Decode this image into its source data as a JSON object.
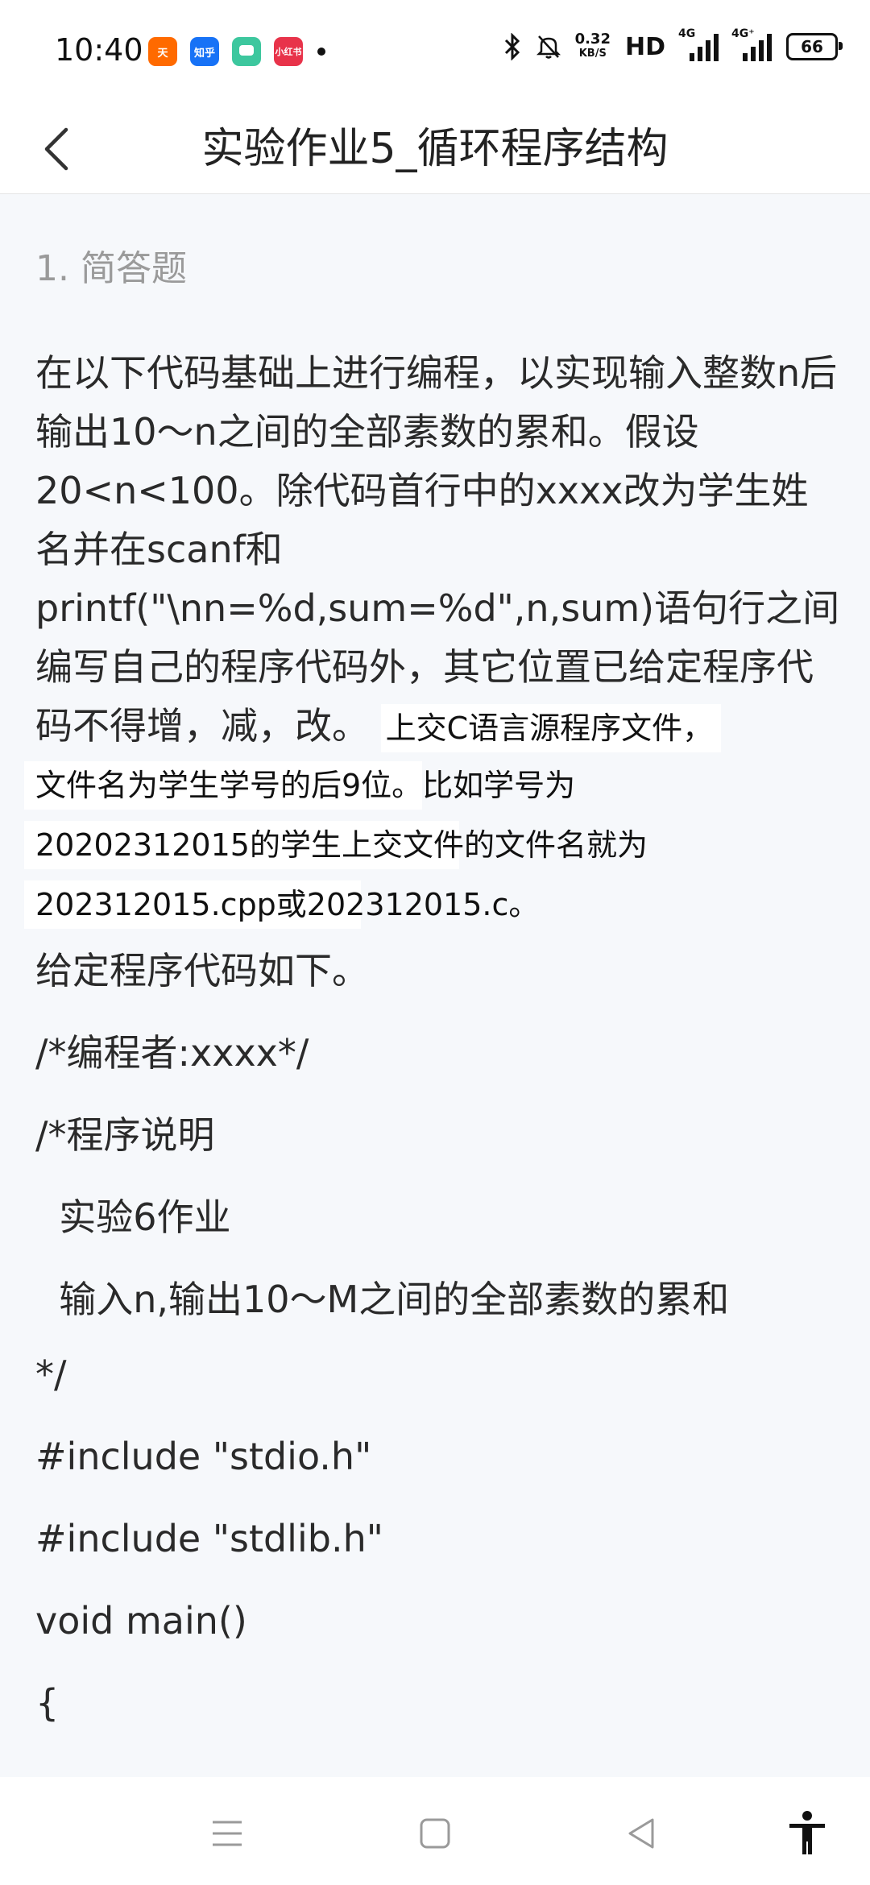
{
  "status_bar": {
    "time": "10:40",
    "apps": [
      {
        "name": "taobao-app-icon",
        "label": "天",
        "color": "#ff6a00"
      },
      {
        "name": "zhihu-app-icon",
        "label": "知乎",
        "color": "#1772f6"
      },
      {
        "name": "chat-app-icon",
        "label": "",
        "color": "#3dc79e"
      },
      {
        "name": "xiaohongshu-app-icon",
        "label": "小红书",
        "color": "#e8334a"
      }
    ],
    "net_speed_value": "0.32",
    "net_speed_unit": "KB/S",
    "hd_label": "HD",
    "signal1_label": "4G",
    "signal2_label": "4G⁺",
    "battery": "66"
  },
  "header": {
    "title": "实验作业5_循环程序结构"
  },
  "question": {
    "type_label": "1. 简答题",
    "body": "在以下代码基础上进行编程，以实现输入整数n后输出10～n之间的全部素数的累和。假设20<n<100。除代码首行中的xxxx改为学生姓名并在scanf和printf(\"\\nn=%d,sum=%d\",n,sum)语句行之间编写自己的程序代码外，其它位置已给定程序代码不得增，减，改。",
    "highlight_lines": [
      "上交C语言源程序文件，",
      "文件名为学生学号的后9位。比如学号为",
      "20202312015的学生上交文件的文件名就为",
      "202312015.cpp或202312015.c。"
    ]
  },
  "code_lines": [
    "给定程序代码如下。",
    "/*编程者:xxxx*/",
    "/*程序说明",
    "  实验6作业",
    "  输入n,输出10～M之间的全部素数的累和",
    "*/",
    "#include \"stdio.h\"",
    "#include \"stdlib.h\"",
    "void main()",
    "{"
  ],
  "colors": {
    "content_bg": "#f6f8fb",
    "muted_text": "#9a9a9a"
  }
}
